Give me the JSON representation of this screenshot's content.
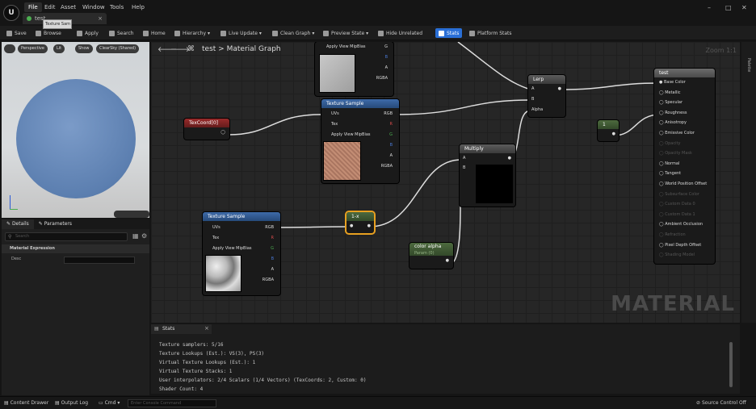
{
  "menu": [
    "File",
    "Edit",
    "Asset",
    "Window",
    "Tools",
    "Help"
  ],
  "doc_tab": {
    "label": "test",
    "tooltip": "Texture Sam"
  },
  "toolbar": [
    {
      "name": "save-button",
      "label": "Save"
    },
    {
      "name": "browse-button",
      "label": "Browse"
    },
    {
      "name": "apply-button",
      "label": "Apply"
    },
    {
      "name": "search-button",
      "label": "Search"
    },
    {
      "name": "home-button",
      "label": "Home"
    },
    {
      "name": "hierarchy-button",
      "label": "Hierarchy"
    },
    {
      "name": "live-update-button",
      "label": "Live Update"
    },
    {
      "name": "clean-graph-button",
      "label": "Clean Graph"
    },
    {
      "name": "preview-state-button",
      "label": "Preview State"
    },
    {
      "name": "hide-unrelated-button",
      "label": "Hide Unrelated"
    },
    {
      "name": "stats-button",
      "label": "Stats"
    },
    {
      "name": "platform-stats-button",
      "label": "Platform Stats"
    }
  ],
  "viewport_buttons": [
    "Perspective",
    "Lit",
    "Show",
    "ClearSky (Shared)"
  ],
  "details": {
    "tabs": [
      "Details",
      "Parameters"
    ],
    "search_placeholder": "Search",
    "section": "Material Expression",
    "desc_label": "Desc"
  },
  "graph": {
    "breadcrumb_root": "test",
    "breadcrumb_sep": ">",
    "breadcrumb_page": "Material Graph",
    "zoom": "Zoom 1:1",
    "watermark": "MATERIAL"
  },
  "palette_label": "Palette",
  "nodes": {
    "tex_top": {
      "pins": [
        "Apply View MipBias",
        "G",
        "B",
        "A",
        "RGBA"
      ]
    },
    "texcoord": {
      "title": "TexCoord[0]"
    },
    "tex_mid": {
      "title": "Texture Sample",
      "inputs": [
        "UVs",
        "Tex",
        "Apply View MipBias"
      ],
      "outputs": [
        "RGB",
        "R",
        "G",
        "B",
        "A",
        "RGBA"
      ]
    },
    "tex_bot": {
      "title": "Texture Sample",
      "inputs": [
        "UVs",
        "Tex",
        "Apply View MipBias"
      ],
      "outputs": [
        "RGB",
        "R",
        "G",
        "B",
        "A",
        "RGBA"
      ]
    },
    "lerp": {
      "title": "Lerp",
      "inputs": [
        "A",
        "B",
        "Alpha"
      ]
    },
    "multiply": {
      "title": "Multiply",
      "inputs": [
        "A",
        "B"
      ]
    },
    "onex": {
      "title": "1-x"
    },
    "color_alpha": {
      "title": "color alpha",
      "subtitle": "Param (0)"
    },
    "const": {
      "title": "1"
    },
    "material": {
      "title": "test",
      "pins": [
        {
          "label": "Base Color",
          "active": true
        },
        {
          "label": "Metallic",
          "active": true
        },
        {
          "label": "Specular",
          "active": true
        },
        {
          "label": "Roughness",
          "active": true
        },
        {
          "label": "Anisotropy",
          "active": true
        },
        {
          "label": "Emissive Color",
          "active": true
        },
        {
          "label": "Opacity",
          "active": false
        },
        {
          "label": "Opacity Mask",
          "active": false
        },
        {
          "label": "Normal",
          "active": true
        },
        {
          "label": "Tangent",
          "active": true
        },
        {
          "label": "World Position Offset",
          "active": true
        },
        {
          "label": "Subsurface Color",
          "active": false
        },
        {
          "label": "Custom Data 0",
          "active": false
        },
        {
          "label": "Custom Data 1",
          "active": false
        },
        {
          "label": "Ambient Occlusion",
          "active": true
        },
        {
          "label": "Refraction",
          "active": false
        },
        {
          "label": "Pixel Depth Offset",
          "active": true
        },
        {
          "label": "Shading Model",
          "active": false
        }
      ]
    }
  },
  "stats": {
    "tab": "Stats",
    "lines": [
      "Texture samplers: 5/16",
      "Texture Lookups (Est.): VS(3), PS(3)",
      "Virtual Texture Lookups (Est.): 1",
      "Virtual Texture Stacks: 1",
      "User interpolators: 2/4 Scalars (1/4 Vectors) (TexCoords: 2, Custom: 0)",
      "Shader Count: 4"
    ]
  },
  "statusbar": {
    "content_drawer": "Content Drawer",
    "output_log": "Output Log",
    "cmd": "Cmd",
    "console_placeholder": "Enter Console Command",
    "source_control": "Source Control Off"
  }
}
